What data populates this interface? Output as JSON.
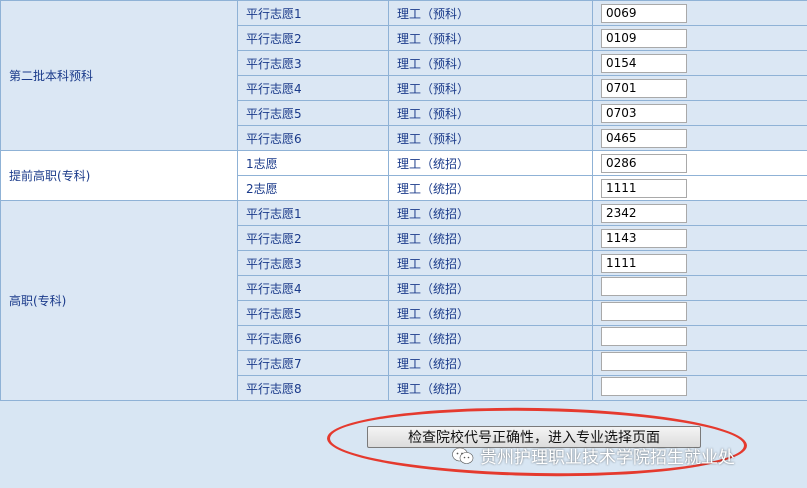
{
  "groups": [
    {
      "batch": "第二批本科预科",
      "rows": [
        {
          "choice": "平行志愿1",
          "category": "理工（预科）",
          "code": "0069"
        },
        {
          "choice": "平行志愿2",
          "category": "理工（预科）",
          "code": "0109"
        },
        {
          "choice": "平行志愿3",
          "category": "理工（预科）",
          "code": "0154"
        },
        {
          "choice": "平行志愿4",
          "category": "理工（预科）",
          "code": "0701"
        },
        {
          "choice": "平行志愿5",
          "category": "理工（预科）",
          "code": "0703"
        },
        {
          "choice": "平行志愿6",
          "category": "理工（预科）",
          "code": "0465"
        }
      ]
    },
    {
      "batch": "提前高职(专科)",
      "rows": [
        {
          "choice": "1志愿",
          "category": "理工（统招）",
          "code": "0286"
        },
        {
          "choice": "2志愿",
          "category": "理工（统招）",
          "code": "1111"
        }
      ]
    },
    {
      "batch": "高职(专科)",
      "rows": [
        {
          "choice": "平行志愿1",
          "category": "理工（统招）",
          "code": "2342"
        },
        {
          "choice": "平行志愿2",
          "category": "理工（统招）",
          "code": "1143"
        },
        {
          "choice": "平行志愿3",
          "category": "理工（统招）",
          "code": "1111"
        },
        {
          "choice": "平行志愿4",
          "category": "理工（统招）",
          "code": ""
        },
        {
          "choice": "平行志愿5",
          "category": "理工（统招）",
          "code": ""
        },
        {
          "choice": "平行志愿6",
          "category": "理工（统招）",
          "code": ""
        },
        {
          "choice": "平行志愿7",
          "category": "理工（统招）",
          "code": ""
        },
        {
          "choice": "平行志愿8",
          "category": "理工（统招）",
          "code": ""
        }
      ]
    }
  ],
  "submit_label": "检查院校代号正确性，进入专业选择页面",
  "watermark": "贵州护理职业技术学院招生就业处",
  "colors": {
    "highlight_ring": "#e53a2e",
    "row_bg": "#dbe7f4",
    "text": "#1a3a8a"
  }
}
